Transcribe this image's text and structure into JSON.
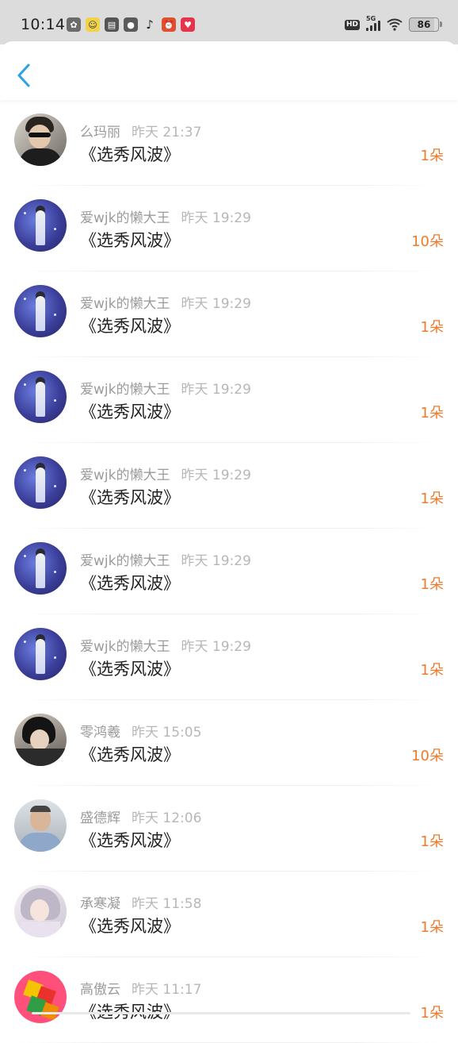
{
  "status_bar": {
    "time": "10:14",
    "network": "5G",
    "hd": "HD",
    "battery": "86",
    "app_icons": [
      "paw-icon",
      "face-app-icon",
      "calendar-icon",
      "wechat-icon",
      "tiktok-icon",
      "alarm-app-icon",
      "red-app-icon"
    ]
  },
  "header": {
    "back_icon": "chevron-left-icon",
    "accent_color": "#2aa3e6"
  },
  "colors": {
    "count": "#f07a2b",
    "name": "#9b9b9b",
    "title": "#222222"
  },
  "items": [
    {
      "name": "么玛丽",
      "time": "昨天 21:37",
      "title": "《选秀风波》",
      "count": "1朵",
      "avatar": "av-a"
    },
    {
      "name": "爱wjk的懒大王",
      "time": "昨天 19:29",
      "title": "《选秀风波》",
      "count": "10朵",
      "avatar": "av-concert"
    },
    {
      "name": "爱wjk的懒大王",
      "time": "昨天 19:29",
      "title": "《选秀风波》",
      "count": "1朵",
      "avatar": "av-concert"
    },
    {
      "name": "爱wjk的懒大王",
      "time": "昨天 19:29",
      "title": "《选秀风波》",
      "count": "1朵",
      "avatar": "av-concert"
    },
    {
      "name": "爱wjk的懒大王",
      "time": "昨天 19:29",
      "title": "《选秀风波》",
      "count": "1朵",
      "avatar": "av-concert"
    },
    {
      "name": "爱wjk的懒大王",
      "time": "昨天 19:29",
      "title": "《选秀风波》",
      "count": "1朵",
      "avatar": "av-concert"
    },
    {
      "name": "爱wjk的懒大王",
      "time": "昨天 19:29",
      "title": "《选秀风波》",
      "count": "1朵",
      "avatar": "av-concert"
    },
    {
      "name": "零鸿羲",
      "time": "昨天 15:05",
      "title": "《选秀风波》",
      "count": "10朵",
      "avatar": "av-b"
    },
    {
      "name": "盛德辉",
      "time": "昨天 12:06",
      "title": "《选秀风波》",
      "count": "1朵",
      "avatar": "av-c"
    },
    {
      "name": "承寒凝",
      "time": "昨天 11:58",
      "title": "《选秀风波》",
      "count": "1朵",
      "avatar": "av-d"
    },
    {
      "name": "高傲云",
      "time": "昨天 11:17",
      "title": "《选秀风波》",
      "count": "1朵",
      "avatar": "av-e"
    }
  ]
}
